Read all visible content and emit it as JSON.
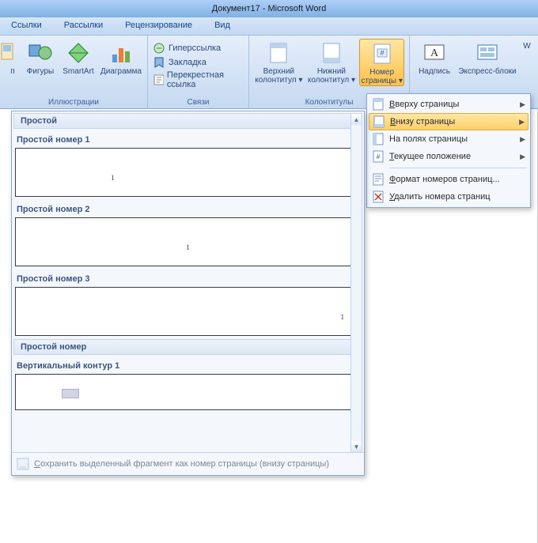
{
  "title": "Документ17 - Microsoft Word",
  "tabs": [
    "Ссылки",
    "Рассылки",
    "Рецензирование",
    "Вид"
  ],
  "ribbon": {
    "group_illustrations": {
      "label": "Иллюстрации",
      "items": [
        "п",
        "Фигуры",
        "SmartArt",
        "Диаграмма"
      ]
    },
    "group_links": {
      "label": "Связи",
      "items": [
        "Гиперссылка",
        "Закладка",
        "Перекрестная ссылка"
      ]
    },
    "group_headerfooter": {
      "label": "Колонтитулы",
      "items": {
        "header": {
          "l1": "Верхний",
          "l2": "колонтитул ▾"
        },
        "footer": {
          "l1": "Нижний",
          "l2": "колонтитул ▾"
        },
        "pagenum": {
          "l1": "Номер",
          "l2": "страницы ▾"
        }
      }
    },
    "group_text": {
      "items": {
        "textbox": "Надпись",
        "quickparts": "Экспресс-блоки",
        "wordart": "W"
      }
    }
  },
  "menu": {
    "top": "Вверху страницы",
    "bottom": "Внизу страницы",
    "margins": "На полях страницы",
    "current": "Текущее положение",
    "format": "Формат номеров страниц...",
    "remove": "Удалить номера страниц"
  },
  "gallery": {
    "cat1": "Простой",
    "item1": "Простой номер 1",
    "item2": "Простой номер 2",
    "item3": "Простой номер 3",
    "cat2": "Простой номер",
    "item4": "Вертикальный контур 1",
    "save": "Сохранить выделенный фрагмент как номер страницы (внизу страницы)",
    "sample": "1"
  }
}
